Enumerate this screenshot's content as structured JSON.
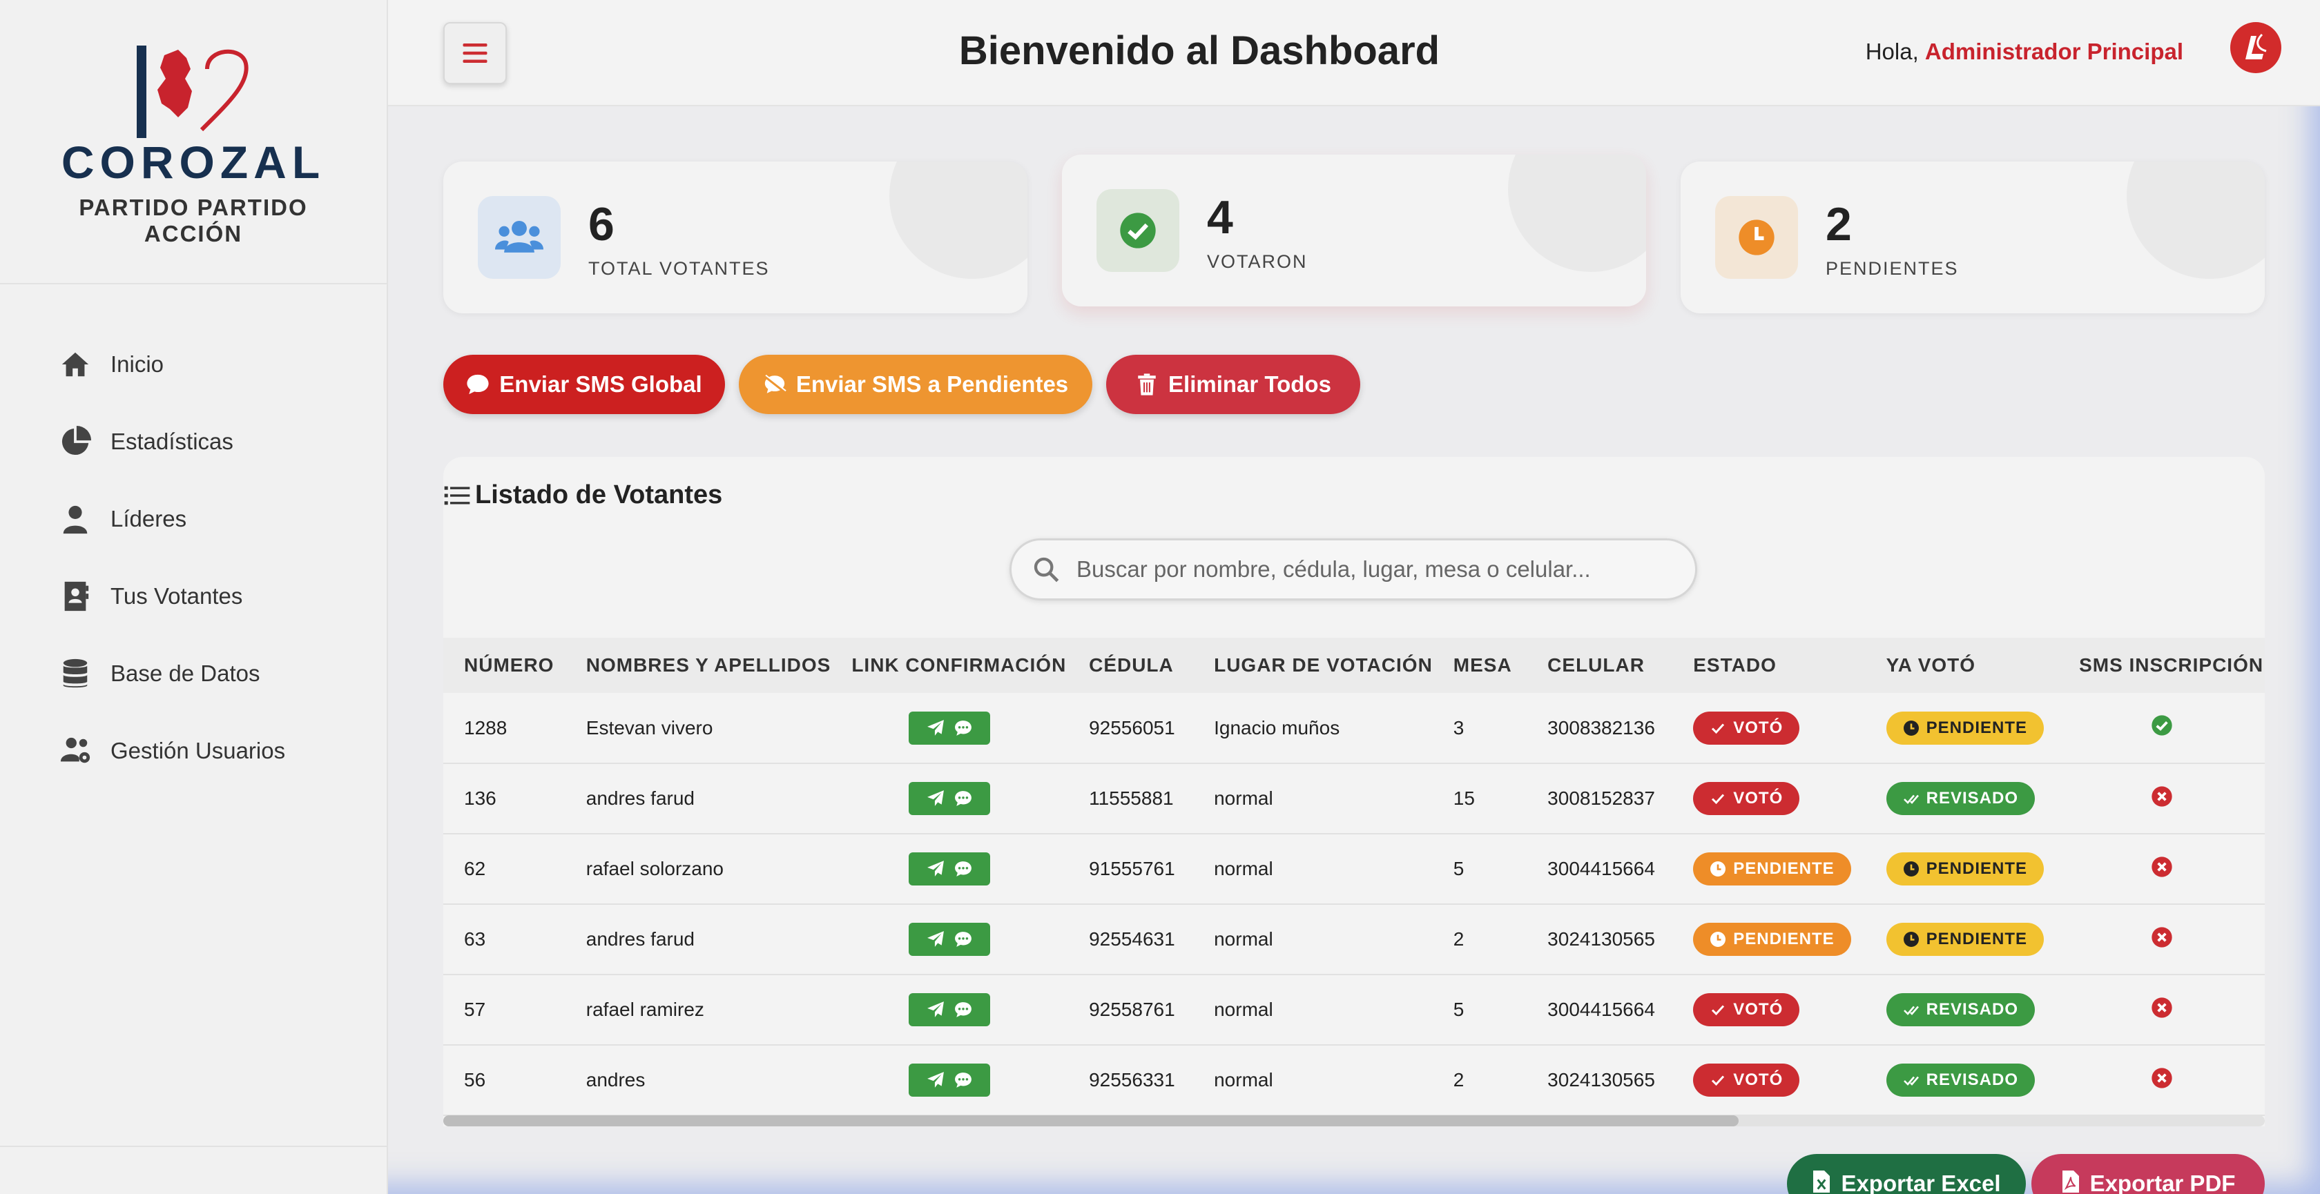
{
  "brand": {
    "logo_text": "COROZAL",
    "subtitle": "PARTIDO PARTIDO ACCIÓN"
  },
  "sidebar": {
    "items": [
      {
        "label": "Inicio",
        "icon": "home-icon"
      },
      {
        "label": "Estadísticas",
        "icon": "pie-chart-icon"
      },
      {
        "label": "Líderes",
        "icon": "user-icon"
      },
      {
        "label": "Tus Votantes",
        "icon": "contact-book-icon"
      },
      {
        "label": "Base de Datos",
        "icon": "database-icon"
      },
      {
        "label": "Gestión Usuarios",
        "icon": "users-cog-icon"
      }
    ]
  },
  "header": {
    "title": "Bienvenido al Dashboard",
    "greeting_prefix": "Hola,",
    "user_name": "Administrador Principal"
  },
  "stats": [
    {
      "value": "6",
      "label": "TOTAL VOTANTES",
      "icon": "users-icon",
      "color": "#4a8fdb"
    },
    {
      "value": "4",
      "label": "VOTARON",
      "icon": "check-circle-icon",
      "color": "#3c9a43"
    },
    {
      "value": "2",
      "label": "PENDIENTES",
      "icon": "clock-icon",
      "color": "#ee8d28"
    }
  ],
  "actions": {
    "sms_global": "Enviar SMS Global",
    "sms_pendientes": "Enviar SMS a Pendientes",
    "eliminar": "Eliminar Todos"
  },
  "list": {
    "title": "Listado de Votantes",
    "search_placeholder": "Buscar por nombre, cédula, lugar, mesa o celular...",
    "columns": [
      "NÚMERO",
      "NOMBRES Y APELLIDOS",
      "LINK CONFIRMACIÓN",
      "CÉDULA",
      "LUGAR DE VOTACIÓN",
      "MESA",
      "CELULAR",
      "ESTADO",
      "YA VOTÓ",
      "SMS INSCRIPCIÓN"
    ],
    "rows": [
      {
        "numero": "1288",
        "nombre": "Estevan vivero",
        "cedula": "92556051",
        "lugar": "Ignacio muños",
        "mesa": "3",
        "celular": "3008382136",
        "estado": "VOTÓ",
        "ya_voto": "PENDIENTE",
        "sms": "ok"
      },
      {
        "numero": "136",
        "nombre": "andres farud",
        "cedula": "11555881",
        "lugar": "normal",
        "mesa": "15",
        "celular": "3008152837",
        "estado": "VOTÓ",
        "ya_voto": "REVISADO",
        "sms": "error"
      },
      {
        "numero": "62",
        "nombre": "rafael solorzano",
        "cedula": "91555761",
        "lugar": "normal",
        "mesa": "5",
        "celular": "3004415664",
        "estado": "PENDIENTE",
        "ya_voto": "PENDIENTE",
        "sms": "error"
      },
      {
        "numero": "63",
        "nombre": "andres farud",
        "cedula": "92554631",
        "lugar": "normal",
        "mesa": "2",
        "celular": "3024130565",
        "estado": "PENDIENTE",
        "ya_voto": "PENDIENTE",
        "sms": "error"
      },
      {
        "numero": "57",
        "nombre": "rafael ramirez",
        "cedula": "92558761",
        "lugar": "normal",
        "mesa": "5",
        "celular": "3004415664",
        "estado": "VOTÓ",
        "ya_voto": "REVISADO",
        "sms": "error"
      },
      {
        "numero": "56",
        "nombre": "andres",
        "cedula": "92556331",
        "lugar": "normal",
        "mesa": "2",
        "celular": "3024130565",
        "estado": "VOTÓ",
        "ya_voto": "REVISADO",
        "sms": "error"
      }
    ]
  },
  "export": {
    "excel": "Exportar Excel",
    "pdf": "Exportar PDF"
  },
  "colors": {
    "primary_red": "#cc2c31",
    "orange": "#ee8d28",
    "yellow": "#f2c230",
    "green": "#3c9a43",
    "excel": "#1f6f43",
    "pdf": "#c63a5c"
  }
}
